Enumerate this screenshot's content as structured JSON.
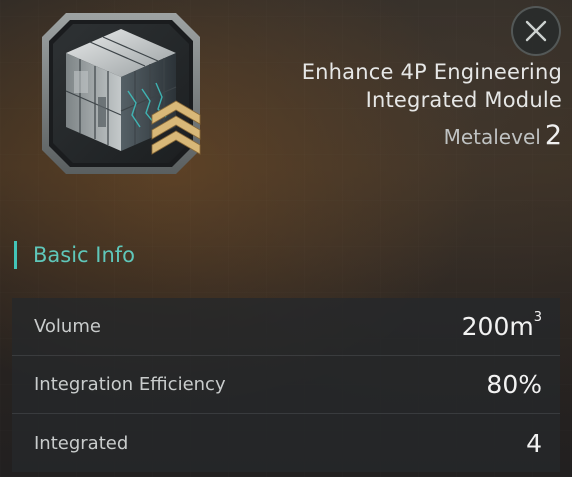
{
  "item": {
    "name_line1": "Enhance 4P Engineering",
    "name_line2": "Integrated Module",
    "metalevel_label": "Metalevel",
    "metalevel_value": "2",
    "icon": "module-cube-icon",
    "rank_icon": "rank-chevrons-icon"
  },
  "close_icon": "close-icon",
  "section": {
    "title": "Basic Info"
  },
  "info_rows": [
    {
      "label": "Volume",
      "value": "200m",
      "unit_sup": "3"
    },
    {
      "label": "Integration Efficiency",
      "value": "80%"
    },
    {
      "label": "Integrated",
      "value": "4"
    }
  ],
  "colors": {
    "accent": "#43c4b8",
    "rank_gold": "#d8b878",
    "text": "#e6e7e6"
  }
}
